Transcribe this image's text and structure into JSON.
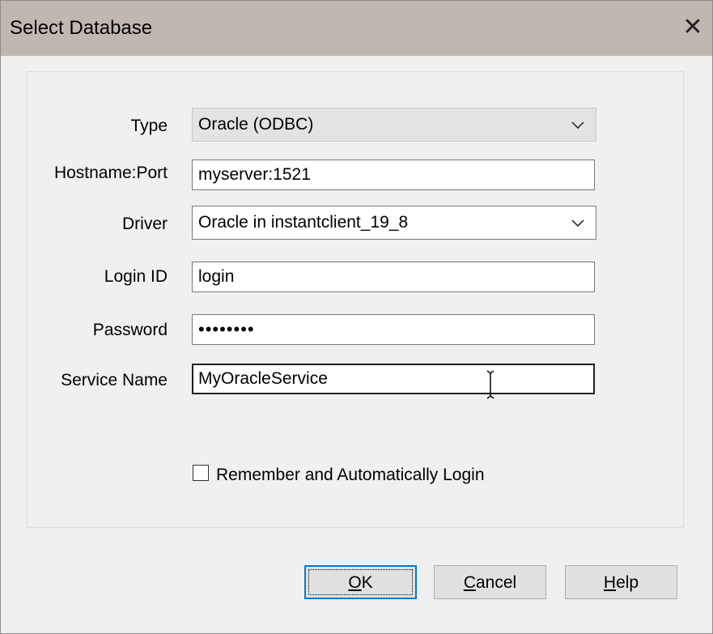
{
  "window": {
    "title": "Select Database",
    "close_glyph": "✕"
  },
  "form": {
    "type": {
      "label": "Type",
      "value": "Oracle (ODBC)"
    },
    "hostname": {
      "label": "Hostname:Port",
      "value": "myserver:1521"
    },
    "driver": {
      "label": "Driver",
      "value": "Oracle in instantclient_19_8"
    },
    "login": {
      "label": "Login ID",
      "value": "login"
    },
    "password": {
      "label": "Password",
      "value": "••••••••"
    },
    "service": {
      "label": "Service Name",
      "value": "MyOracleService"
    },
    "remember": {
      "label": "Remember and Automatically Login",
      "checked": false
    }
  },
  "buttons": {
    "ok": {
      "mnemonic": "O",
      "rest": "K"
    },
    "cancel": {
      "mnemonic": "C",
      "rest": "ancel"
    },
    "help": {
      "mnemonic": "H",
      "rest": "elp"
    }
  },
  "icons": {
    "dropdown": "chevron-down-icon",
    "cursor": "text-cursor-icon",
    "close": "close-icon"
  },
  "colors": {
    "titlebar": "#c2b6b1",
    "default_button_border": "#0078d7",
    "background": "#f0f0f0"
  }
}
